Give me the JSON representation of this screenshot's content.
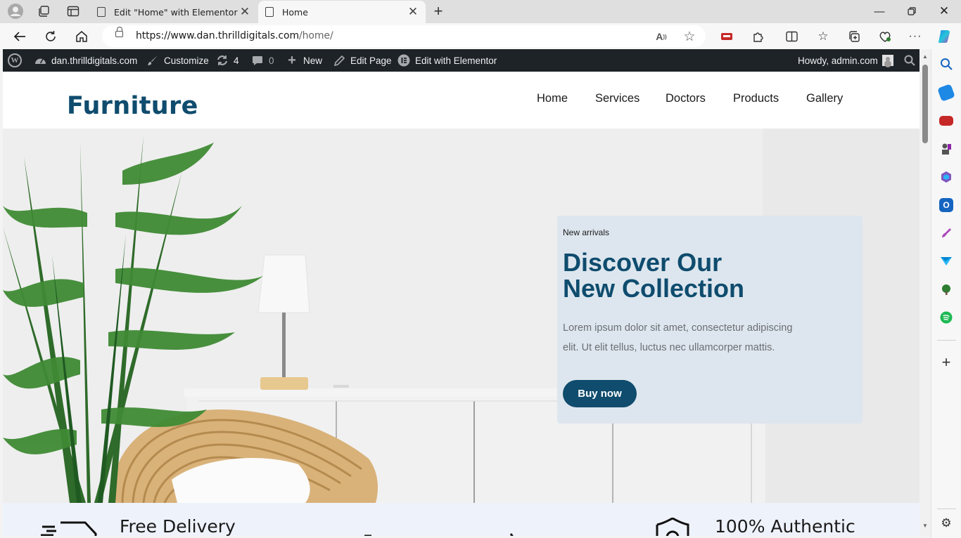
{
  "browser": {
    "tabs": [
      {
        "title": "Edit \"Home\" with Elementor",
        "active": false
      },
      {
        "title": "Home",
        "active": true
      }
    ],
    "url_host": "https://www.dan.thrilldigitals.com",
    "url_path": "/home/",
    "toolbar_icons": [
      "read-aloud-icon",
      "favorite-star-icon",
      "extension-icon",
      "puzzle-icon",
      "split-screen-icon",
      "favorites-icon",
      "collections-icon",
      "browser-essentials-icon",
      "more-icon",
      "copilot-icon"
    ],
    "sidebar_icons": [
      "search-icon",
      "shopping-tag-icon",
      "toolbox-icon",
      "chess-icon",
      "m365-icon",
      "outlook-icon",
      "designer-icon",
      "send-icon",
      "tree-icon",
      "spotify-icon",
      "add-icon",
      "settings-icon"
    ]
  },
  "wp_admin_bar": {
    "site": "dan.thrilldigitals.com",
    "customize": "Customize",
    "updates_count": "4",
    "comments_count": "0",
    "new": "New",
    "edit_page": "Edit Page",
    "edit_elementor": "Edit with Elementor",
    "howdy": "Howdy, admin.com"
  },
  "site": {
    "logo": "Furniture",
    "menu": [
      "Home",
      "Services",
      "Doctors",
      "Products",
      "Gallery"
    ]
  },
  "hero": {
    "eyebrow": "New arrivals",
    "title_line1": "Discover Our",
    "title_line2": "New Collection",
    "description": "Lorem ipsum dolor sit amet, consectetur adipiscing elit. Ut elit tellus, luctus nec ullamcorper mattis.",
    "button": "Buy now"
  },
  "features": [
    "Free Delivery",
    "100% Authentic"
  ],
  "colors": {
    "brand": "#0f4c6e",
    "card_bg": "#dde6ee",
    "admin_bar": "#1d2327",
    "features_bg": "#eef2fb"
  }
}
